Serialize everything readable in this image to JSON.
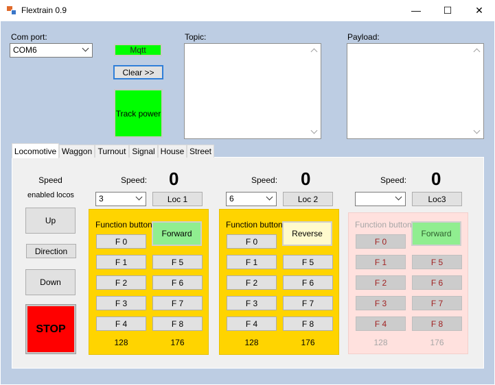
{
  "window": {
    "title": "Flextrain 0.9",
    "controls": {
      "minimize": "—",
      "maximize": "☐",
      "close": "✕"
    }
  },
  "com_port": {
    "label": "Com port:",
    "value": "COM6"
  },
  "mqtt_label": "Mqtt",
  "clear_label": "Clear >>",
  "track_power_label": "Track power",
  "topic_label": "Topic:",
  "payload_label": "Payload:",
  "tabs": [
    "Locomotive",
    "Waggon",
    "Turnout",
    "Signal",
    "House",
    "Street"
  ],
  "left_panel": {
    "speed_label": "Speed",
    "enabled_label": "enabled locos",
    "up_label": "Up",
    "direction_label": "Direction",
    "down_label": "Down",
    "stop_label": "STOP"
  },
  "locos": [
    {
      "speed_label": "Speed:",
      "speed_value": "0",
      "combo_value": "3",
      "loc_button": "Loc 1",
      "function_label": "Function button",
      "direction": "Forward",
      "functions": [
        "F 0",
        "F 1",
        "F 2",
        "F 3",
        "F 4",
        "F 5",
        "F 6",
        "F 7",
        "F 8"
      ],
      "steps_a": "128",
      "steps_b": "176"
    },
    {
      "speed_label": "Speed:",
      "speed_value": "0",
      "combo_value": "6",
      "loc_button": "Loc 2",
      "function_label": "Function button",
      "direction": "Reverse",
      "functions": [
        "F 0",
        "F 1",
        "F 2",
        "F 3",
        "F 4",
        "F 5",
        "F 6",
        "F 7",
        "F 8"
      ],
      "steps_a": "128",
      "steps_b": "176"
    },
    {
      "speed_label": "Speed:",
      "speed_value": "0",
      "combo_value": "",
      "loc_button": "Loc3",
      "function_label": "Function button",
      "direction": "Forward",
      "functions": [
        "F 0",
        "F 1",
        "F 2",
        "F 3",
        "F 4",
        "F 5",
        "F 6",
        "F 7",
        "F 8"
      ],
      "steps_a": "128",
      "steps_b": "176"
    }
  ],
  "colors": {
    "client_bg": "#bdcde3",
    "green": "#00ff00",
    "yellow_panel": "#ffd400",
    "pink_panel": "#ffe1de",
    "stop": "#ff0000"
  }
}
